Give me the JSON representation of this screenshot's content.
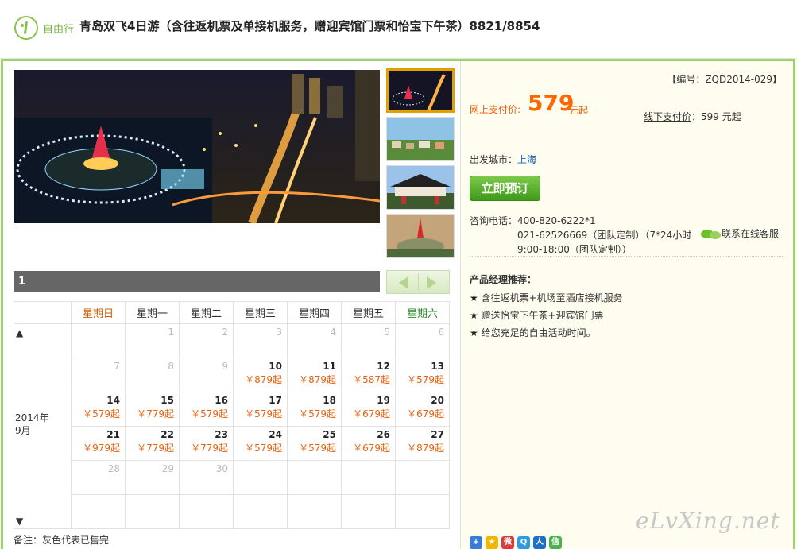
{
  "header": {
    "tag": "自由行",
    "title": "青岛双飞4日游（含往返机票及单接机服务，赠迎宾馆门票和怡宝下午茶）8821/8854"
  },
  "gallery": {
    "pager_text": "1"
  },
  "calendar": {
    "weekdays": [
      "星期日",
      "星期一",
      "星期二",
      "星期三",
      "星期四",
      "星期五",
      "星期六"
    ],
    "month_year": "2014年",
    "month": "9月",
    "up_glyph": "▲",
    "down_glyph": "▼",
    "weeks": [
      [
        {
          "d": "",
          "p": ""
        },
        {
          "d": "1",
          "p": "",
          "g": true
        },
        {
          "d": "2",
          "p": "",
          "g": true
        },
        {
          "d": "3",
          "p": "",
          "g": true
        },
        {
          "d": "4",
          "p": "",
          "g": true
        },
        {
          "d": "5",
          "p": "",
          "g": true
        },
        {
          "d": "6",
          "p": "",
          "g": true
        }
      ],
      [
        {
          "d": "7",
          "p": "",
          "g": true
        },
        {
          "d": "8",
          "p": "",
          "g": true
        },
        {
          "d": "9",
          "p": "",
          "g": true
        },
        {
          "d": "10",
          "p": "￥879起"
        },
        {
          "d": "11",
          "p": "￥879起"
        },
        {
          "d": "12",
          "p": "￥587起"
        },
        {
          "d": "13",
          "p": "￥579起"
        }
      ],
      [
        {
          "d": "14",
          "p": "￥579起"
        },
        {
          "d": "15",
          "p": "￥779起"
        },
        {
          "d": "16",
          "p": "￥579起"
        },
        {
          "d": "17",
          "p": "￥579起"
        },
        {
          "d": "18",
          "p": "￥579起"
        },
        {
          "d": "19",
          "p": "￥679起"
        },
        {
          "d": "20",
          "p": "￥679起"
        }
      ],
      [
        {
          "d": "21",
          "p": "￥979起"
        },
        {
          "d": "22",
          "p": "￥779起"
        },
        {
          "d": "23",
          "p": "￥779起"
        },
        {
          "d": "24",
          "p": "￥579起"
        },
        {
          "d": "25",
          "p": "￥579起"
        },
        {
          "d": "26",
          "p": "￥679起"
        },
        {
          "d": "27",
          "p": "￥879起"
        }
      ],
      [
        {
          "d": "28",
          "p": "",
          "g": true
        },
        {
          "d": "29",
          "p": "",
          "g": true
        },
        {
          "d": "30",
          "p": "",
          "g": true
        },
        {
          "d": "",
          "p": ""
        },
        {
          "d": "",
          "p": ""
        },
        {
          "d": "",
          "p": ""
        },
        {
          "d": "",
          "p": ""
        }
      ],
      [
        {
          "d": "",
          "p": ""
        },
        {
          "d": "",
          "p": ""
        },
        {
          "d": "",
          "p": ""
        },
        {
          "d": "",
          "p": ""
        },
        {
          "d": "",
          "p": ""
        },
        {
          "d": "",
          "p": ""
        },
        {
          "d": "",
          "p": ""
        }
      ]
    ],
    "note": "备注：灰色代表已售完"
  },
  "info": {
    "code": "【编号：ZQD2014-029】",
    "online_label": "网上支付价:",
    "online_price": "579",
    "online_suffix": "元起",
    "offline_label": "线下支付价",
    "offline_value": "：599 元起",
    "city_label": "出发城市：",
    "city": "上海",
    "book_button": "立即预订",
    "contact_label": "咨询电话：",
    "contact_lines": [
      "400-820-6222*1",
      "021-62526669（团队定制）（7*24小时",
      "9:00-18:00（团队定制））"
    ],
    "chat_label": "联系在线客服",
    "rec_title": "产品经理推荐：",
    "rec_items": [
      "含往返机票+机场至酒店接机服务",
      "赠送怡宝下午茶+迎宾馆门票",
      "给您充足的自由活动时间。"
    ]
  },
  "watermark": "eLvXing.net",
  "share_icons": [
    "plus-icon",
    "star-icon",
    "weibo-icon",
    "qzone-icon",
    "renren-icon",
    "wechat-icon"
  ],
  "colors": {
    "accent_green": "#9cd36a",
    "price_orange": "#ff6600"
  }
}
